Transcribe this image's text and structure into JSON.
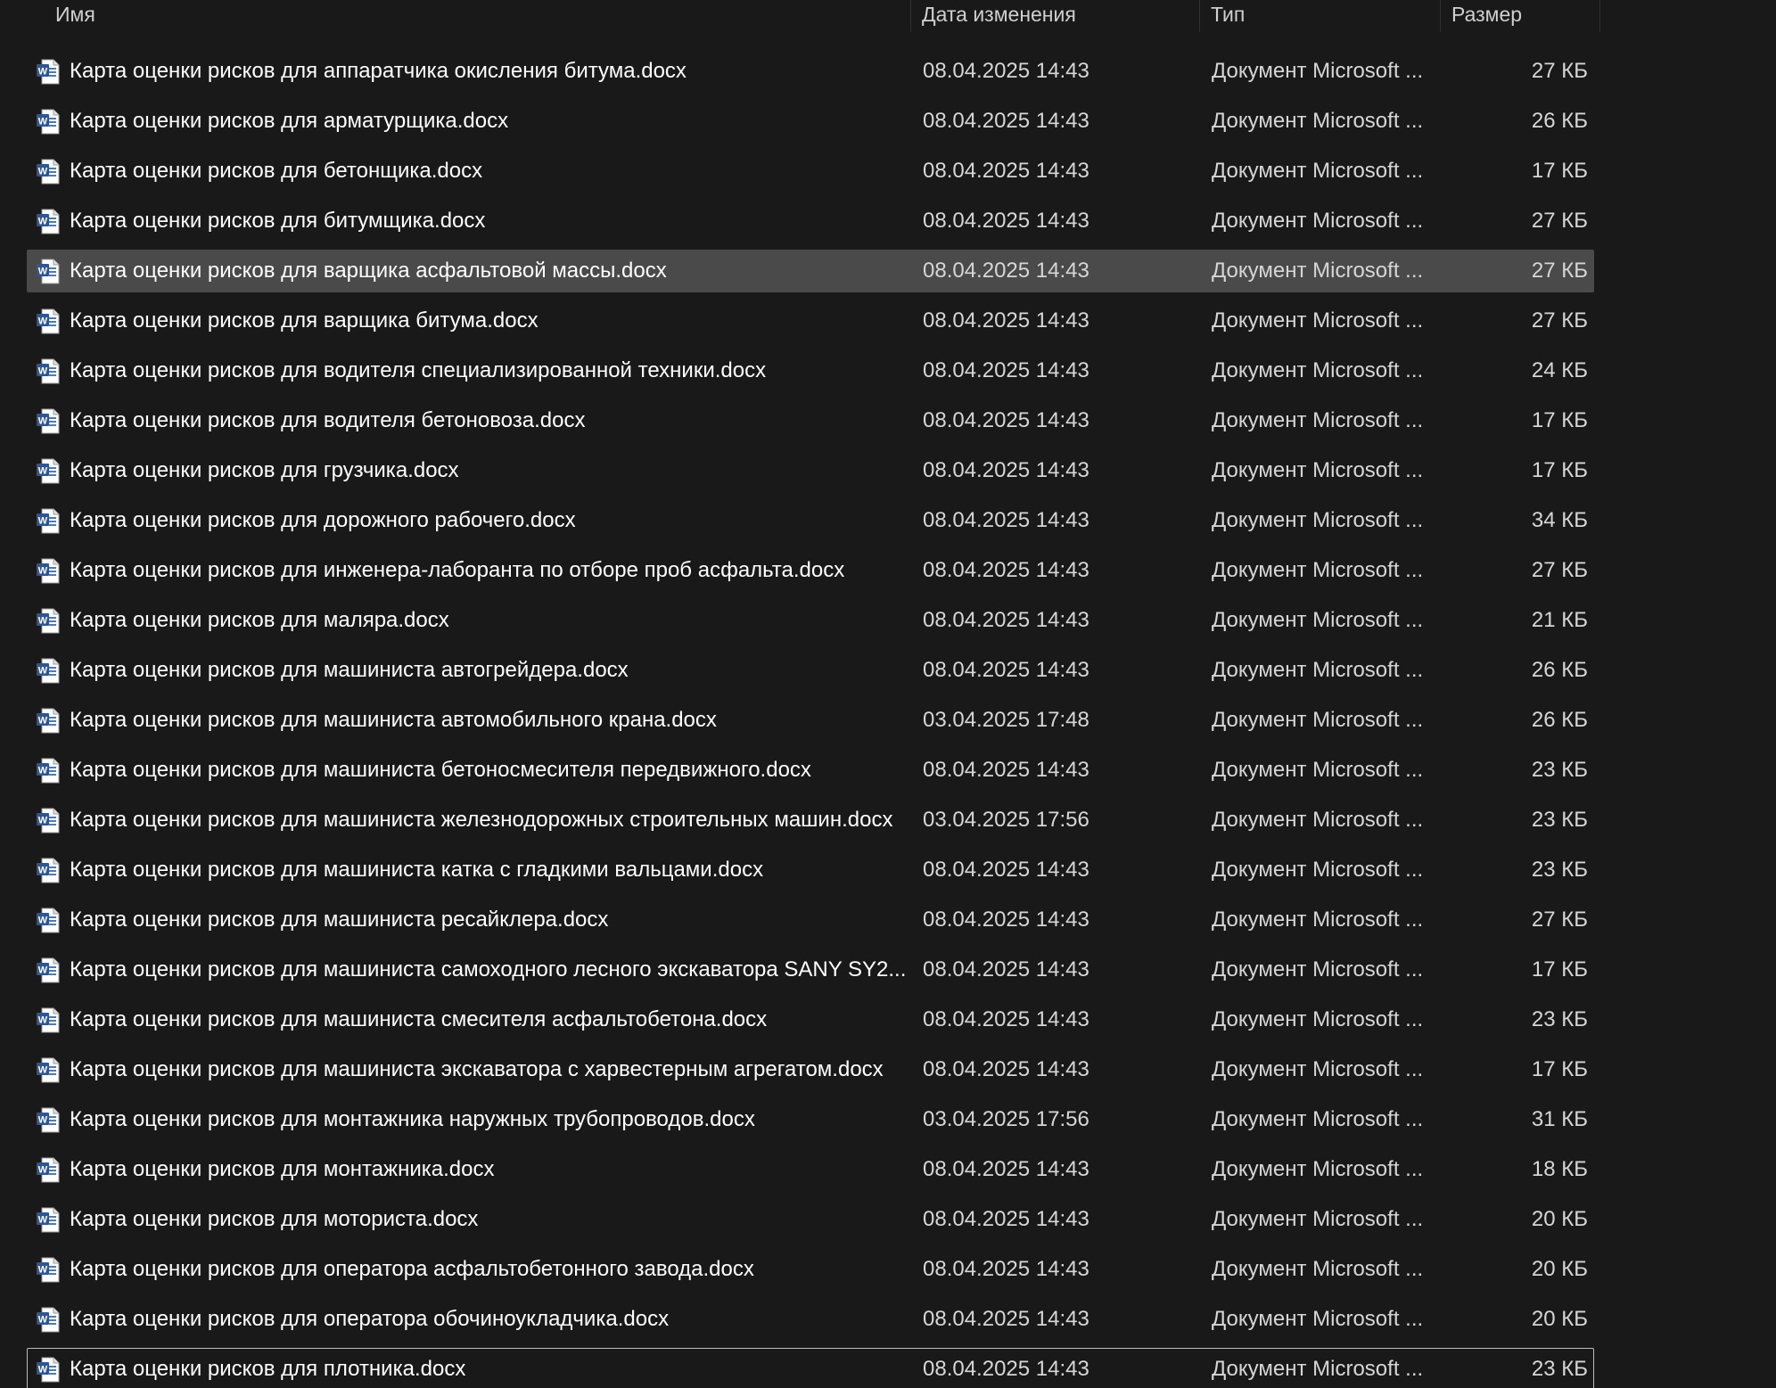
{
  "columns": {
    "name": "Имя",
    "date": "Дата изменения",
    "type": "Тип",
    "size": "Размер"
  },
  "icon": "word-document-icon",
  "colors": {
    "background": "#191919",
    "selected_row": "#4a4a4a",
    "focus_border": "#bdbdbd",
    "word_blue": "#2b579a"
  },
  "selected_index": 4,
  "focused_index": 26,
  "files": [
    {
      "name": "Карта оценки рисков для аппаратчика окисления битума.docx",
      "date": "08.04.2025 14:43",
      "type": "Документ Microsoft ...",
      "size": "27 КБ"
    },
    {
      "name": "Карта оценки рисков для арматурщика.docx",
      "date": "08.04.2025 14:43",
      "type": "Документ Microsoft ...",
      "size": "26 КБ"
    },
    {
      "name": "Карта оценки рисков для бетонщика.docx",
      "date": "08.04.2025 14:43",
      "type": "Документ Microsoft ...",
      "size": "17 КБ"
    },
    {
      "name": "Карта оценки рисков для битумщика.docx",
      "date": "08.04.2025 14:43",
      "type": "Документ Microsoft ...",
      "size": "27 КБ"
    },
    {
      "name": "Карта оценки рисков для варщика асфальтовой массы.docx",
      "date": "08.04.2025 14:43",
      "type": "Документ Microsoft ...",
      "size": "27 КБ"
    },
    {
      "name": "Карта оценки рисков для варщика битума.docx",
      "date": "08.04.2025 14:43",
      "type": "Документ Microsoft ...",
      "size": "27 КБ"
    },
    {
      "name": "Карта оценки рисков для водителя специализированной техники.docx",
      "date": "08.04.2025 14:43",
      "type": "Документ Microsoft ...",
      "size": "24 КБ"
    },
    {
      "name": "Карта оценки рисков для водителя бетоновоза.docx",
      "date": "08.04.2025 14:43",
      "type": "Документ Microsoft ...",
      "size": "17 КБ"
    },
    {
      "name": "Карта оценки рисков для грузчика.docx",
      "date": "08.04.2025 14:43",
      "type": "Документ Microsoft ...",
      "size": "17 КБ"
    },
    {
      "name": "Карта оценки рисков для дорожного рабочего.docx",
      "date": "08.04.2025 14:43",
      "type": "Документ Microsoft ...",
      "size": "34 КБ"
    },
    {
      "name": "Карта оценки рисков для инженера-лаборанта по отборе проб асфальта.docx",
      "date": "08.04.2025 14:43",
      "type": "Документ Microsoft ...",
      "size": "27 КБ"
    },
    {
      "name": "Карта оценки рисков для маляра.docx",
      "date": "08.04.2025 14:43",
      "type": "Документ Microsoft ...",
      "size": "21 КБ"
    },
    {
      "name": "Карта оценки рисков для машиниста автогрейдера.docx",
      "date": "08.04.2025 14:43",
      "type": "Документ Microsoft ...",
      "size": "26 КБ"
    },
    {
      "name": "Карта оценки рисков для машиниста автомобильного крана.docx",
      "date": "03.04.2025 17:48",
      "type": "Документ Microsoft ...",
      "size": "26 КБ"
    },
    {
      "name": "Карта оценки рисков для машиниста бетоносмесителя передвижного.docx",
      "date": "08.04.2025 14:43",
      "type": "Документ Microsoft ...",
      "size": "23 КБ"
    },
    {
      "name": "Карта оценки рисков для машиниста железнодорожных строительных машин.docx",
      "date": "03.04.2025 17:56",
      "type": "Документ Microsoft ...",
      "size": "23 КБ"
    },
    {
      "name": "Карта оценки рисков для машиниста катка с гладкими вальцами.docx",
      "date": "08.04.2025 14:43",
      "type": "Документ Microsoft ...",
      "size": "23 КБ"
    },
    {
      "name": "Карта оценки рисков для машиниста ресайклера.docx",
      "date": "08.04.2025 14:43",
      "type": "Документ Microsoft ...",
      "size": "27 КБ"
    },
    {
      "name": "Карта оценки рисков для машиниста самоходного лесного экскаватора SANY SY2...",
      "date": "08.04.2025 14:43",
      "type": "Документ Microsoft ...",
      "size": "17 КБ"
    },
    {
      "name": "Карта оценки рисков для машиниста смесителя асфальтобетона.docx",
      "date": "08.04.2025 14:43",
      "type": "Документ Microsoft ...",
      "size": "23 КБ"
    },
    {
      "name": "Карта оценки рисков для машиниста экскаватора с харвестерным агрегатом.docx",
      "date": "08.04.2025 14:43",
      "type": "Документ Microsoft ...",
      "size": "17 КБ"
    },
    {
      "name": "Карта оценки рисков для монтажника наружных трубопроводов.docx",
      "date": "03.04.2025 17:56",
      "type": "Документ Microsoft ...",
      "size": "31 КБ"
    },
    {
      "name": "Карта оценки рисков для монтажника.docx",
      "date": "08.04.2025 14:43",
      "type": "Документ Microsoft ...",
      "size": "18 КБ"
    },
    {
      "name": "Карта оценки рисков для моториста.docx",
      "date": "08.04.2025 14:43",
      "type": "Документ Microsoft ...",
      "size": "20 КБ"
    },
    {
      "name": "Карта оценки рисков для оператора асфальтобетонного завода.docx",
      "date": "08.04.2025 14:43",
      "type": "Документ Microsoft ...",
      "size": "20 КБ"
    },
    {
      "name": "Карта оценки рисков для оператора обочиноукладчика.docx",
      "date": "08.04.2025 14:43",
      "type": "Документ Microsoft ...",
      "size": "20 КБ"
    },
    {
      "name": "Карта оценки рисков для плотника.docx",
      "date": "08.04.2025 14:43",
      "type": "Документ Microsoft ...",
      "size": "23 КБ"
    }
  ]
}
